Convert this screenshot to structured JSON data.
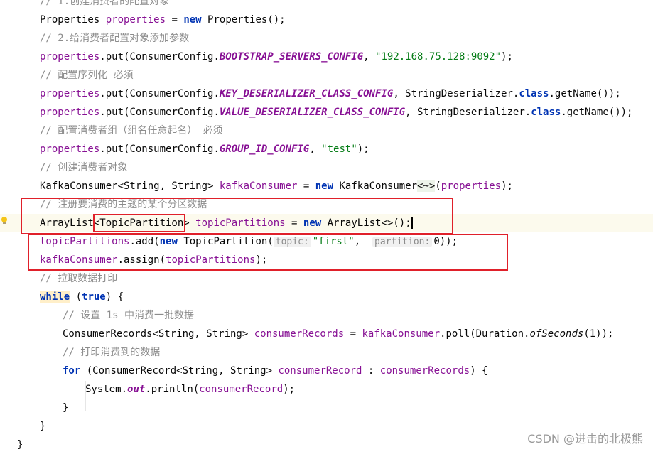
{
  "editor": {
    "lines": [
      {
        "indent": 1,
        "tokens": [
          {
            "t": "// 1.创建消费者的配置对象",
            "c": "c"
          }
        ]
      },
      {
        "indent": 1,
        "tokens": [
          {
            "t": "Properties ",
            "c": ""
          },
          {
            "t": "properties",
            "c": "v"
          },
          {
            "t": " = ",
            "c": ""
          },
          {
            "t": "new",
            "c": "k"
          },
          {
            "t": " Properties();",
            "c": ""
          }
        ]
      },
      {
        "indent": 1,
        "tokens": [
          {
            "t": "// 2.给消费者配置对象添加参数",
            "c": "c"
          }
        ]
      },
      {
        "indent": 1,
        "tokens": [
          {
            "t": "properties",
            "c": "v"
          },
          {
            "t": ".put(ConsumerConfig.",
            "c": ""
          },
          {
            "t": "BOOTSTRAP_SERVERS_CONFIG",
            "c": "f"
          },
          {
            "t": ", ",
            "c": ""
          },
          {
            "t": "\"192.168.75.128:9092\"",
            "c": "s"
          },
          {
            "t": ");",
            "c": ""
          }
        ]
      },
      {
        "indent": 1,
        "tokens": [
          {
            "t": "// 配置序列化 必须",
            "c": "c"
          }
        ]
      },
      {
        "indent": 1,
        "tokens": [
          {
            "t": "properties",
            "c": "v"
          },
          {
            "t": ".put(ConsumerConfig.",
            "c": ""
          },
          {
            "t": "KEY_DESERIALIZER_CLASS_CONFIG",
            "c": "f"
          },
          {
            "t": ", StringDeserializer.",
            "c": ""
          },
          {
            "t": "class",
            "c": "k"
          },
          {
            "t": ".getName());",
            "c": ""
          }
        ]
      },
      {
        "indent": 1,
        "tokens": [
          {
            "t": "properties",
            "c": "v"
          },
          {
            "t": ".put(ConsumerConfig.",
            "c": ""
          },
          {
            "t": "VALUE_DESERIALIZER_CLASS_CONFIG",
            "c": "f"
          },
          {
            "t": ", StringDeserializer.",
            "c": ""
          },
          {
            "t": "class",
            "c": "k"
          },
          {
            "t": ".getName());",
            "c": ""
          }
        ]
      },
      {
        "indent": 1,
        "tokens": [
          {
            "t": "// 配置消费者组（组名任意起名） 必须",
            "c": "c"
          }
        ]
      },
      {
        "indent": 1,
        "tokens": [
          {
            "t": "properties",
            "c": "v"
          },
          {
            "t": ".put(ConsumerConfig.",
            "c": ""
          },
          {
            "t": "GROUP_ID_CONFIG",
            "c": "f"
          },
          {
            "t": ", ",
            "c": ""
          },
          {
            "t": "\"test\"",
            "c": "s"
          },
          {
            "t": ");",
            "c": ""
          }
        ]
      },
      {
        "indent": 1,
        "tokens": [
          {
            "t": "// 创建消费者对象",
            "c": "c"
          }
        ]
      },
      {
        "indent": 1,
        "tokens": [
          {
            "t": "KafkaConsumer<String, String> ",
            "c": ""
          },
          {
            "t": "kafkaConsumer",
            "c": "v"
          },
          {
            "t": " = ",
            "c": ""
          },
          {
            "t": "new",
            "c": "k"
          },
          {
            "t": " KafkaConsumer",
            "c": ""
          },
          {
            "t": "<~>",
            "c": "gen"
          },
          {
            "t": "(",
            "c": ""
          },
          {
            "t": "properties",
            "c": "v"
          },
          {
            "t": ");",
            "c": ""
          }
        ]
      },
      {
        "indent": 1,
        "tokens": [
          {
            "t": "// 注册要消费的主题的某个分区数据",
            "c": "c"
          }
        ]
      },
      {
        "indent": 1,
        "current": true,
        "tokens": [
          {
            "t": "ArrayList<TopicPartition> ",
            "c": ""
          },
          {
            "t": "topicPartitions",
            "c": "v"
          },
          {
            "t": " = ",
            "c": ""
          },
          {
            "t": "new",
            "c": "k"
          },
          {
            "t": " ArrayList<>();",
            "c": ""
          },
          {
            "t": "",
            "c": "caret"
          }
        ]
      },
      {
        "indent": 1,
        "tokens": [
          {
            "t": "topicPartitions",
            "c": "v"
          },
          {
            "t": ".add(",
            "c": ""
          },
          {
            "t": "new",
            "c": "k"
          },
          {
            "t": " TopicPartition(",
            "c": ""
          },
          {
            "t": "topic:",
            "c": "hint"
          },
          {
            "t": "\"first\"",
            "c": "s"
          },
          {
            "t": ",  ",
            "c": ""
          },
          {
            "t": "partition:",
            "c": "hint"
          },
          {
            "t": "0));",
            "c": ""
          }
        ]
      },
      {
        "indent": 1,
        "tokens": [
          {
            "t": "kafkaConsumer",
            "c": "v"
          },
          {
            "t": ".assign(",
            "c": ""
          },
          {
            "t": "topicPartitions",
            "c": "v"
          },
          {
            "t": ");",
            "c": ""
          }
        ]
      },
      {
        "indent": 1,
        "tokens": [
          {
            "t": "// 拉取数据打印",
            "c": "c"
          }
        ]
      },
      {
        "indent": 1,
        "tokens": [
          {
            "t": "while",
            "c": "k hl-true"
          },
          {
            "t": " (",
            "c": ""
          },
          {
            "t": "true",
            "c": "k"
          },
          {
            "t": ") {",
            "c": ""
          }
        ]
      },
      {
        "indent": 2,
        "tokens": [
          {
            "t": "// 设置 1s 中消费一批数据",
            "c": "c"
          }
        ]
      },
      {
        "indent": 2,
        "tokens": [
          {
            "t": "ConsumerRecords<String, String> ",
            "c": ""
          },
          {
            "t": "consumerRecords",
            "c": "v"
          },
          {
            "t": " = ",
            "c": ""
          },
          {
            "t": "kafkaConsumer",
            "c": "v"
          },
          {
            "t": ".poll(Duration.",
            "c": ""
          },
          {
            "t": "ofSeconds",
            "c": "m"
          },
          {
            "t": "(1));",
            "c": ""
          }
        ]
      },
      {
        "indent": 2,
        "tokens": [
          {
            "t": "// 打印消费到的数据",
            "c": "c"
          }
        ]
      },
      {
        "indent": 2,
        "tokens": [
          {
            "t": "for",
            "c": "k"
          },
          {
            "t": " (ConsumerRecord<String, String> ",
            "c": ""
          },
          {
            "t": "consumerRecord",
            "c": "v"
          },
          {
            "t": " : ",
            "c": ""
          },
          {
            "t": "consumerRecords",
            "c": "v"
          },
          {
            "t": ") {",
            "c": ""
          }
        ]
      },
      {
        "indent": 3,
        "tokens": [
          {
            "t": "System.",
            "c": ""
          },
          {
            "t": "out",
            "c": "fi"
          },
          {
            "t": ".println(",
            "c": ""
          },
          {
            "t": "consumerRecord",
            "c": "v"
          },
          {
            "t": ");",
            "c": ""
          }
        ]
      },
      {
        "indent": 2,
        "tokens": [
          {
            "t": "}",
            "c": ""
          }
        ]
      },
      {
        "indent": 1,
        "tokens": [
          {
            "t": "}",
            "c": ""
          }
        ]
      },
      {
        "indent": 0,
        "tokens": [
          {
            "t": "}",
            "c": ""
          }
        ]
      }
    ]
  },
  "watermark": "CSDN @进击的北极熊",
  "colors": {
    "annotation_box": "#e0202a",
    "keyword": "#0033b3",
    "string": "#067d17",
    "comment": "#8c8c8c",
    "variable": "#871094"
  },
  "icons": {
    "gutter": "lightbulb-icon"
  }
}
